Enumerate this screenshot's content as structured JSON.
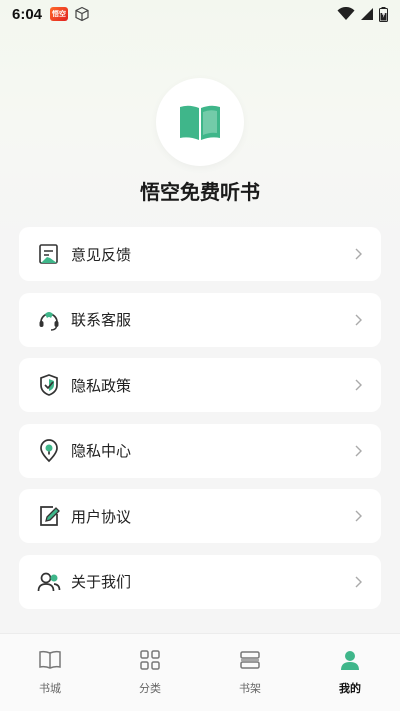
{
  "status": {
    "time": "6:04",
    "app_badge": "悟空"
  },
  "app": {
    "name": "悟空免费听书"
  },
  "menu": [
    {
      "label": "意见反馈",
      "icon": "feedback-icon"
    },
    {
      "label": "联系客服",
      "icon": "headset-icon"
    },
    {
      "label": "隐私政策",
      "icon": "shield-check-icon"
    },
    {
      "label": "隐私中心",
      "icon": "location-pin-icon"
    },
    {
      "label": "用户协议",
      "icon": "edit-document-icon"
    },
    {
      "label": "关于我们",
      "icon": "users-icon"
    }
  ],
  "tabs": [
    {
      "label": "书城",
      "icon": "book-icon",
      "active": false
    },
    {
      "label": "分类",
      "icon": "grid-icon",
      "active": false
    },
    {
      "label": "书架",
      "icon": "bookshelf-icon",
      "active": false
    },
    {
      "label": "我的",
      "icon": "user-icon",
      "active": true
    }
  ],
  "colors": {
    "accent": "#3fb68a",
    "icon_dark": "#333333",
    "background": "#f5f5f5"
  }
}
